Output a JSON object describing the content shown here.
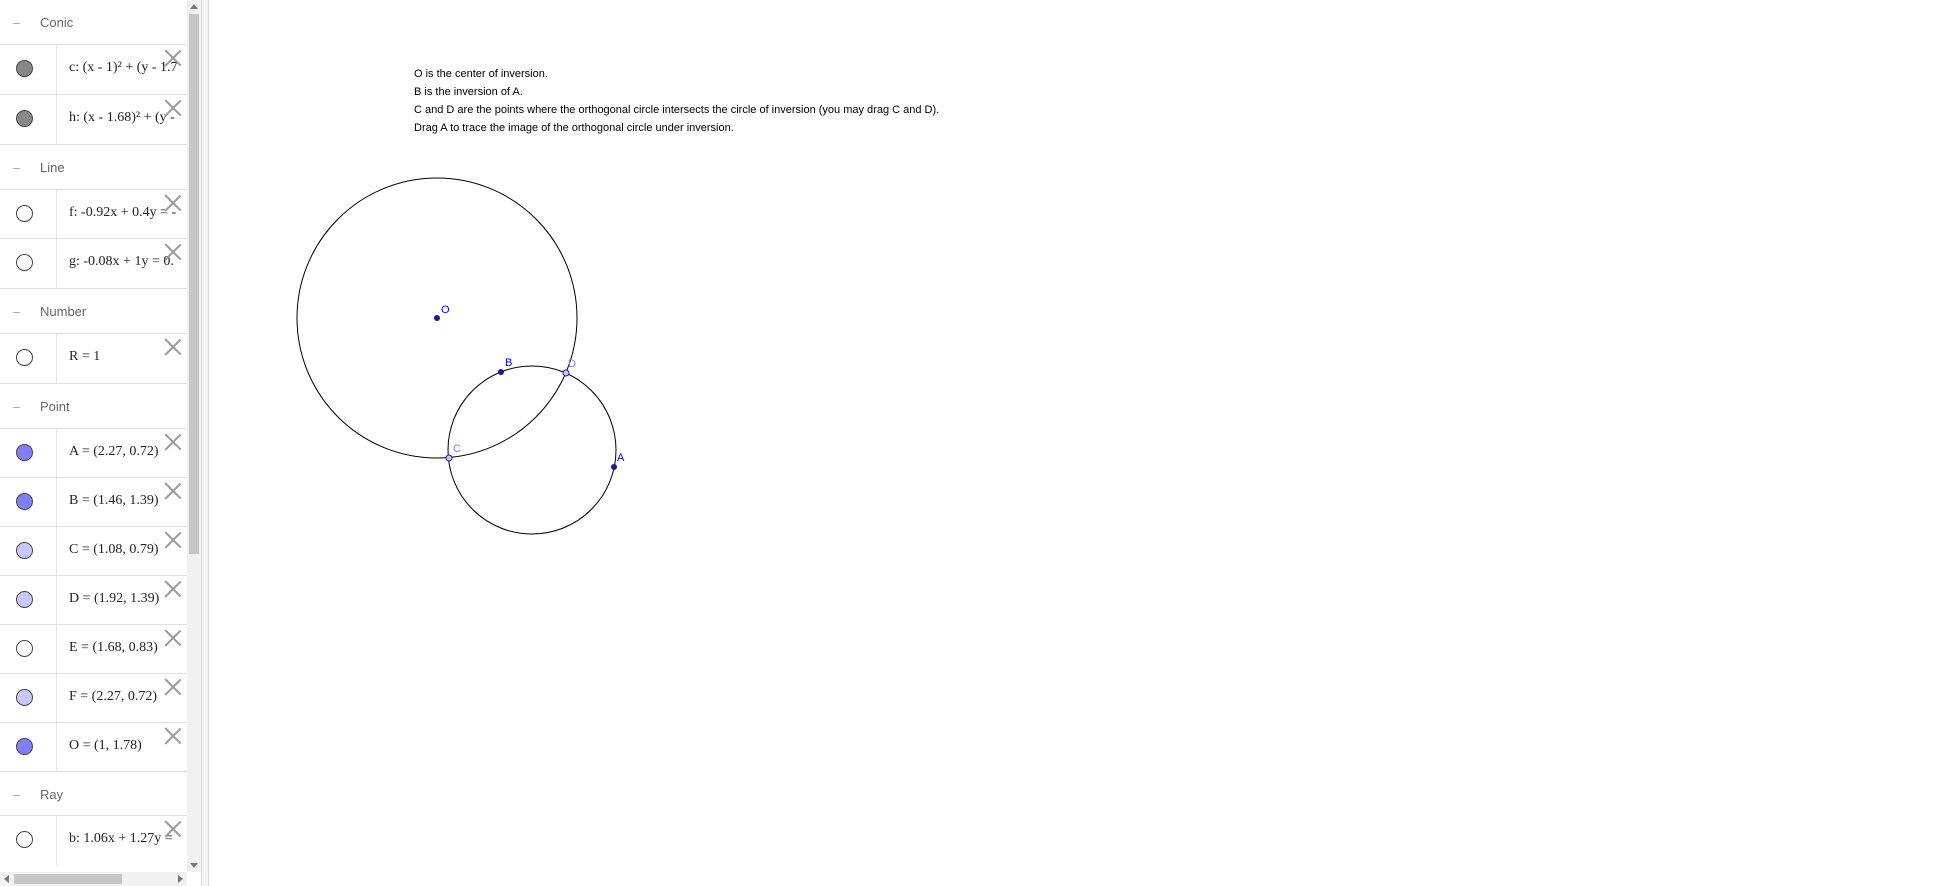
{
  "algebra": {
    "categories": {
      "conic": "Conic",
      "line": "Line",
      "number": "Number",
      "point": "Point",
      "ray": "Ray"
    },
    "rows": [
      {
        "name": "c",
        "text": "c: (x - 1)² + (y - 1.7",
        "color": "#888888"
      },
      {
        "name": "h",
        "text": "h: (x - 1.68)² + (y -",
        "color": "#888888"
      },
      {
        "name": "f",
        "text": "f: -0.92x + 0.4y = -",
        "color": "#ffffff"
      },
      {
        "name": "g",
        "text": "g: -0.08x + 1y = 0.",
        "color": "#ffffff"
      },
      {
        "name": "R",
        "text": "R = 1",
        "color": "#ffffff"
      },
      {
        "name": "A",
        "text": "A = (2.27, 0.72)",
        "color": "#8080ff"
      },
      {
        "name": "B",
        "text": "B = (1.46, 1.39)",
        "color": "#8080ff"
      },
      {
        "name": "C",
        "text": "C = (1.08, 0.79)",
        "color": "#c8c8ff"
      },
      {
        "name": "D",
        "text": "D = (1.92, 1.39)",
        "color": "#c8c8ff"
      },
      {
        "name": "E",
        "text": "E = (1.68, 0.83)",
        "color": "#ffffff"
      },
      {
        "name": "F",
        "text": "F = (2.27, 0.72)",
        "color": "#c8c8ff"
      },
      {
        "name": "O",
        "text": "O = (1, 1.78)",
        "color": "#8080ff"
      },
      {
        "name": "b",
        "text": "b: 1.06x + 1.27y =",
        "color": "#ffffff"
      }
    ]
  },
  "instructions": {
    "line1": "O is the center of inversion.",
    "line2": "B is the inversion of A.",
    "line3": "C and D are the points where the orthogonal circle intersects the circle of inversion (you may drag C and D).",
    "line4": "Drag A to trace the image of the orthogonal circle under inversion."
  },
  "points": {
    "O": "O",
    "B": "B",
    "D": "D",
    "C": "C",
    "A": "A"
  },
  "colors": {
    "point_dark": "#1a1a8c",
    "point_light": "#6b6be0",
    "label_blue": "#0000ff",
    "label_light": "#7a7aff"
  }
}
